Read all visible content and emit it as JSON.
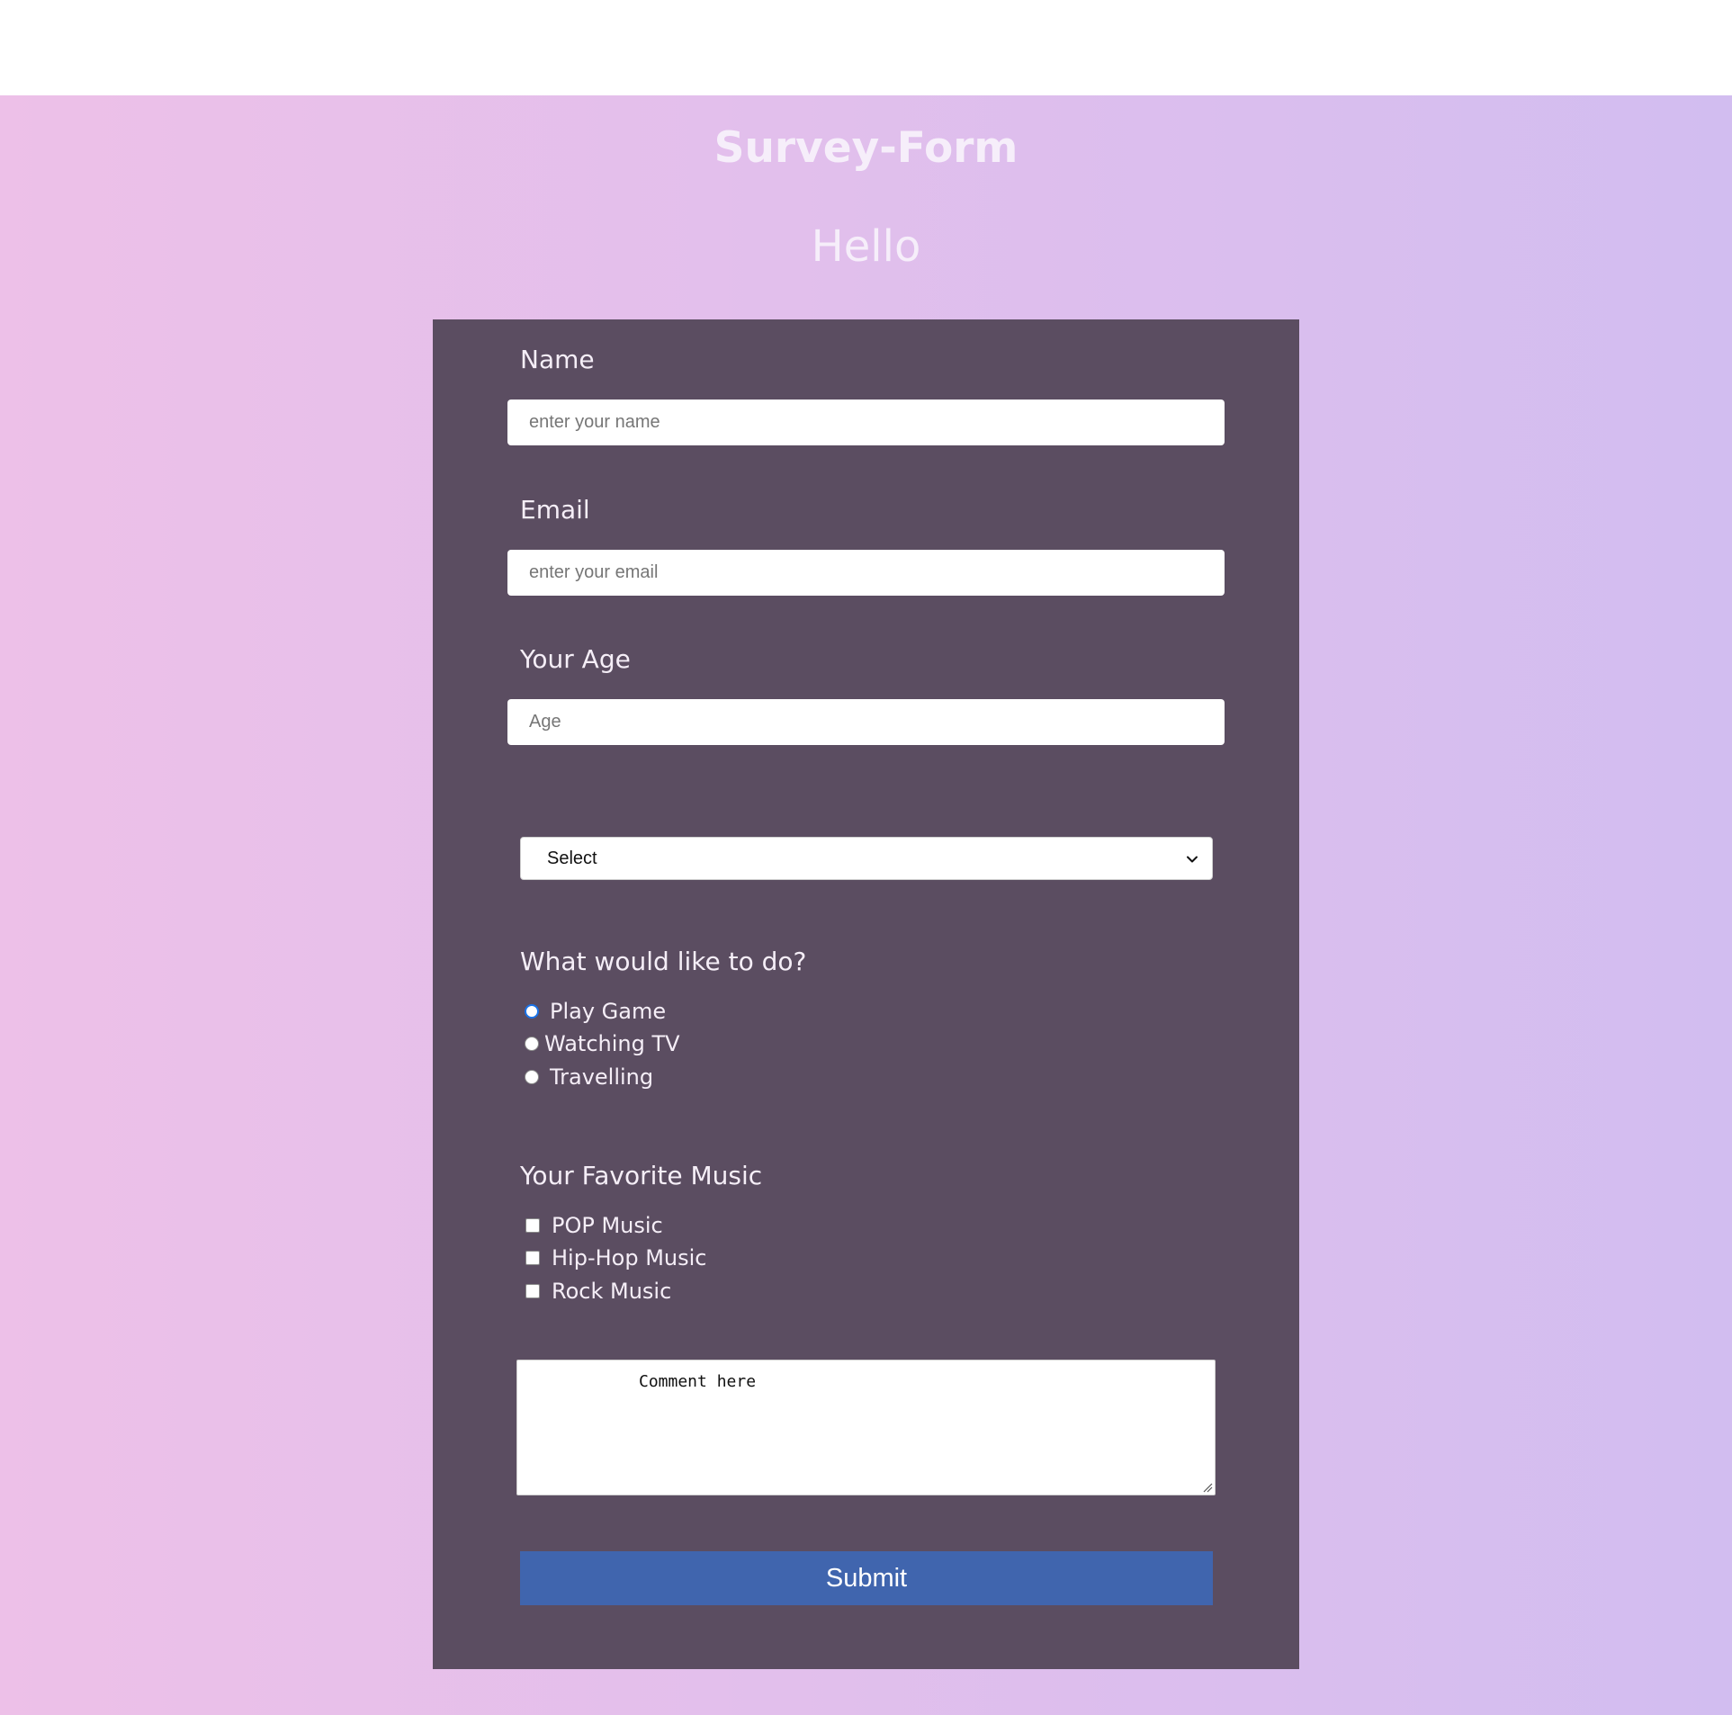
{
  "header": {
    "title": "Survey-Form",
    "subtitle": "Hello"
  },
  "form": {
    "name": {
      "label": "Name",
      "placeholder": "enter your name",
      "value": ""
    },
    "email": {
      "label": "Email",
      "placeholder": "enter your email",
      "value": ""
    },
    "age": {
      "label": "Your Age",
      "placeholder": "Age",
      "value": ""
    },
    "select": {
      "selected": "Select"
    },
    "activity": {
      "question": "What would like to do?",
      "options": [
        {
          "label": "Play Game",
          "checked": true
        },
        {
          "label": "Watching TV",
          "checked": false
        },
        {
          "label": "Travelling",
          "checked": false
        }
      ]
    },
    "music": {
      "question": "Your Favorite Music",
      "options": [
        {
          "label": "POP Music",
          "checked": false
        },
        {
          "label": "Hip-Hop Music",
          "checked": false
        },
        {
          "label": "Rock Music",
          "checked": false
        }
      ]
    },
    "comment": {
      "text": "Comment here"
    },
    "submit_label": "Submit"
  },
  "icons": {
    "select": "chevron-down-icon",
    "textarea": "resize-handle-icon"
  },
  "colors": {
    "card": "#5b4d61",
    "submit": "#4065ae",
    "gradient_left": "#edc0e8",
    "gradient_right": "#d2bdf0",
    "radio_accent": "#1a73e8"
  }
}
